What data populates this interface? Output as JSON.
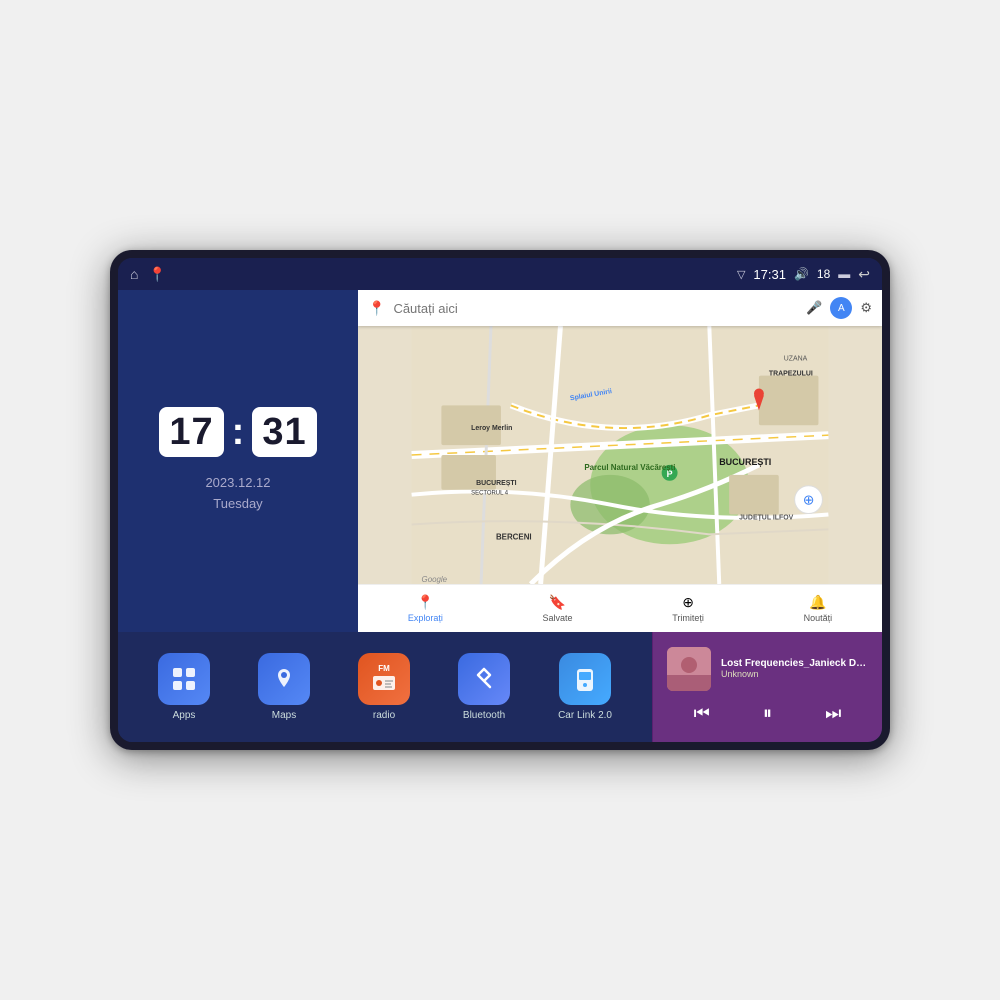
{
  "device": {
    "status_bar": {
      "left_icons": [
        "home-icon",
        "maps-pin-icon"
      ],
      "signal_icon": "▽",
      "time": "17:31",
      "volume_icon": "🔊",
      "battery_level": "18",
      "battery_icon": "🔋",
      "back_icon": "↩"
    },
    "clock": {
      "hours": "17",
      "minutes": "31",
      "date": "2023.12.12",
      "day": "Tuesday"
    },
    "map": {
      "search_placeholder": "Căutați aici",
      "nav_items": [
        {
          "label": "Explorați",
          "active": true,
          "icon": "📍"
        },
        {
          "label": "Salvate",
          "active": false,
          "icon": "🔖"
        },
        {
          "label": "Trimiteți",
          "active": false,
          "icon": "⊕"
        },
        {
          "label": "Noutăți",
          "active": false,
          "icon": "🔔"
        }
      ],
      "labels": [
        "Parcul Natural Văcărești",
        "Leroy Merlin",
        "BUCUREȘTI SECTORUL 4",
        "BUCUREȘTI",
        "JUDEȚUL ILFOV",
        "BERCENI",
        "Splaiul Unirii",
        "Google",
        "TRAPEZULUI",
        "UZANA"
      ]
    },
    "apps": [
      {
        "id": "apps",
        "label": "Apps",
        "icon": "⊞",
        "icon_class": "icon-apps"
      },
      {
        "id": "maps",
        "label": "Maps",
        "icon": "📍",
        "icon_class": "icon-maps"
      },
      {
        "id": "radio",
        "label": "radio",
        "icon": "📻",
        "icon_class": "icon-radio"
      },
      {
        "id": "bluetooth",
        "label": "Bluetooth",
        "icon": "🔷",
        "icon_class": "icon-bluetooth"
      },
      {
        "id": "carlink",
        "label": "Car Link 2.0",
        "icon": "📱",
        "icon_class": "icon-carlink"
      }
    ],
    "music": {
      "title": "Lost Frequencies_Janieck Devy-...",
      "artist": "Unknown",
      "prev_icon": "⏮",
      "play_icon": "⏸",
      "next_icon": "⏭"
    }
  }
}
